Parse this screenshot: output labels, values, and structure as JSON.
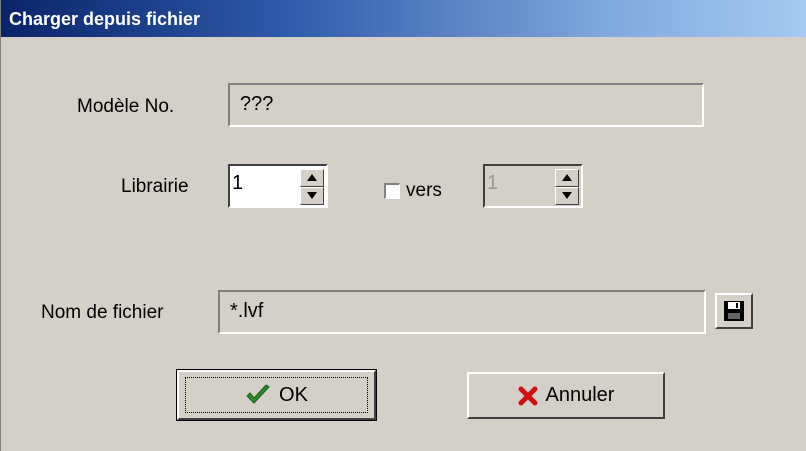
{
  "window": {
    "title": "Charger depuis fichier"
  },
  "model": {
    "label": "Modèle No.",
    "value": "???"
  },
  "library": {
    "label": "Librairie",
    "from_value": "1",
    "to_checkbox_label": "vers",
    "to_checked": false,
    "to_value": "1"
  },
  "file": {
    "label": "Nom de fichier",
    "value": "*.lvf",
    "browse_icon": "floppy-disk-icon"
  },
  "buttons": {
    "ok_label": "OK",
    "ok_icon": "checkmark-icon",
    "cancel_label": "Annuler",
    "cancel_icon": "x-cross-icon"
  },
  "colors": {
    "title_gradient_start": "#0a246a",
    "title_gradient_end": "#a6caf0",
    "dialog_bg": "#d4d0c8",
    "ok_check": "#2e8b2e",
    "cancel_x": "#cc1111"
  }
}
